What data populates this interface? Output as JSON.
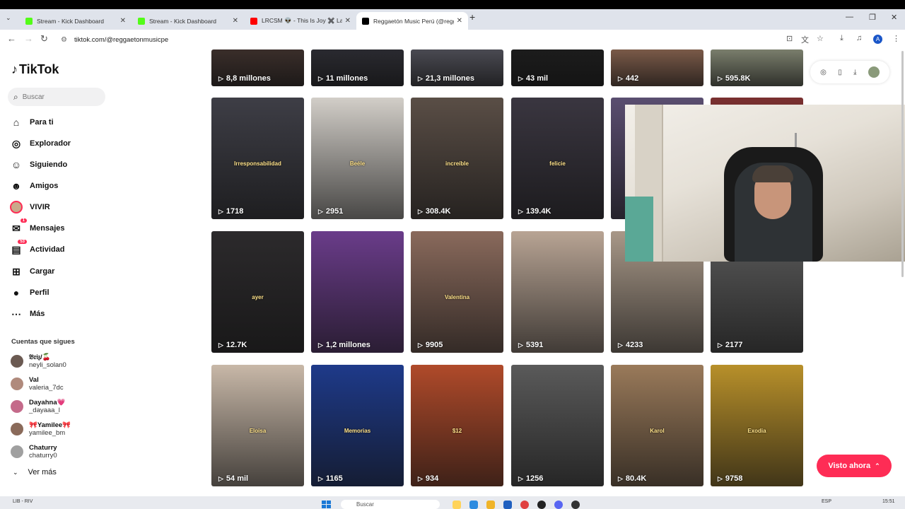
{
  "browser": {
    "tabs": [
      {
        "title": "Stream - Kick Dashboard",
        "favicon": "kick-icon",
        "color": "#53fc18",
        "active": false
      },
      {
        "title": "Stream - Kick Dashboard",
        "favicon": "kick-icon",
        "color": "#53fc18",
        "active": false
      },
      {
        "title": "LRCSM 👽 - This Is Joy ✖️ Lanm…",
        "favicon": "youtube-icon",
        "color": "#ff0000",
        "active": false
      },
      {
        "title": "Reggaetón Music Perú (@regga…",
        "favicon": "tiktok-icon",
        "color": "#000000",
        "active": true
      }
    ],
    "url": "tiktok.com/@reggaetonmusicpe",
    "profile_letter": "A"
  },
  "sidebar": {
    "logo": "TikTok",
    "search_placeholder": "Buscar",
    "nav": [
      {
        "label": "Para ti",
        "icon": "home-icon"
      },
      {
        "label": "Explorador",
        "icon": "compass-icon"
      },
      {
        "label": "Siguiendo",
        "icon": "following-icon"
      },
      {
        "label": "Amigos",
        "icon": "friends-icon"
      },
      {
        "label": "VIVIR",
        "icon": "live-icon"
      },
      {
        "label": "Mensajes",
        "icon": "messages-icon",
        "badge": "1"
      },
      {
        "label": "Actividad",
        "icon": "activity-icon",
        "badge": "53"
      },
      {
        "label": "Cargar",
        "icon": "upload-icon"
      },
      {
        "label": "Perfil",
        "icon": "profile-icon"
      },
      {
        "label": "Más",
        "icon": "more-icon"
      }
    ],
    "following_title": "Cuentas que sigues",
    "following": [
      {
        "name": "𝔅𝔯𝔦𝔷/🍒",
        "user": "neyli_solan0",
        "color": "#6b5a52"
      },
      {
        "name": "Val",
        "user": "valeria_7dc",
        "color": "#b08a7c"
      },
      {
        "name": "Dayahna💗",
        "user": "_dayaaa_l",
        "color": "#c46a8a"
      },
      {
        "name": "🎀Yamilee🎀",
        "user": "yamilee_bm",
        "color": "#8a6a5a"
      },
      {
        "name": "Chaturry",
        "user": "chaturry0",
        "color": "#a0a0a0"
      }
    ],
    "see_more": "Ver más"
  },
  "videos": [
    {
      "count": "8,8 millones",
      "color": "#3a2e2a",
      "caption": ""
    },
    {
      "count": "11 millones",
      "color": "#2a2a30",
      "caption": ""
    },
    {
      "count": "21,3 millones",
      "color": "#4a4a52",
      "caption": ""
    },
    {
      "count": "43 mil",
      "color": "#1c1c1c",
      "caption": ""
    },
    {
      "count": "442",
      "color": "#7a5a48",
      "caption": ""
    },
    {
      "count": "595.8K",
      "color": "#7a7e6c",
      "caption": ""
    },
    {
      "count": "1718",
      "color": "#3e3e46",
      "caption": "Irresponsabilidad"
    },
    {
      "count": "2951",
      "color": "#d2cec8",
      "caption": "Beéle"
    },
    {
      "count": "308.4K",
      "color": "#5a4e46",
      "caption": "increíble"
    },
    {
      "count": "139.4K",
      "color": "#3a3640",
      "caption": "felicie"
    },
    {
      "count": "",
      "color": "#5a4e70",
      "caption": ""
    },
    {
      "count": "",
      "color": "#7a3030",
      "caption": ""
    },
    {
      "count": "12.7K",
      "color": "#2c2a2c",
      "caption": "ayer"
    },
    {
      "count": "1,2 millones",
      "color": "#6a3c8a",
      "caption": ""
    },
    {
      "count": "9905",
      "color": "#8a6a5c",
      "caption": "Valentina"
    },
    {
      "count": "5391",
      "color": "#b8a494",
      "caption": ""
    },
    {
      "count": "4233",
      "color": "#a89888",
      "caption": ""
    },
    {
      "count": "2177",
      "color": "#5a5a5a",
      "caption": ""
    },
    {
      "count": "54 mil",
      "color": "#c8b8a8",
      "caption": "Eloisa"
    },
    {
      "count": "1165",
      "color": "#1e3a8a",
      "caption": "Memorias"
    },
    {
      "count": "934",
      "color": "#b04a2a",
      "caption": "$12"
    },
    {
      "count": "1256",
      "color": "#5a5a5a",
      "caption": ""
    },
    {
      "count": "80.4K",
      "color": "#9a7a5a",
      "caption": "Karol"
    },
    {
      "count": "9758",
      "color": "#b8902a",
      "caption": "Exodia"
    }
  ],
  "right_button": "Visto ahora",
  "taskbar": {
    "left": "LIB - RIV",
    "search": "Buscar",
    "lang": "ESP",
    "time": "15:51"
  }
}
